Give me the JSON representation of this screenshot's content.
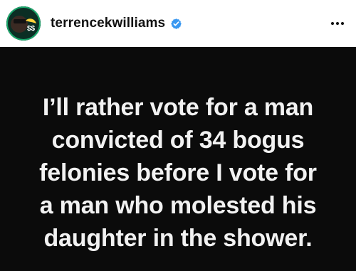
{
  "post": {
    "username": "terrencekwilliams",
    "verified": true,
    "more_label": "•••",
    "text_lines": [
      "I’ll rather vote for a  man",
      "convicted of 34 bogus",
      "felonies before I vote for",
      "a man who molested his",
      "daughter in the shower."
    ]
  },
  "colors": {
    "header_background": "#ffffff",
    "post_background": "#0b0b0b",
    "post_text": "#f2f2f2",
    "verified_badge": "#3897f0"
  },
  "icons": {
    "verified": "verified-badge-icon",
    "more": "more-options-icon"
  }
}
